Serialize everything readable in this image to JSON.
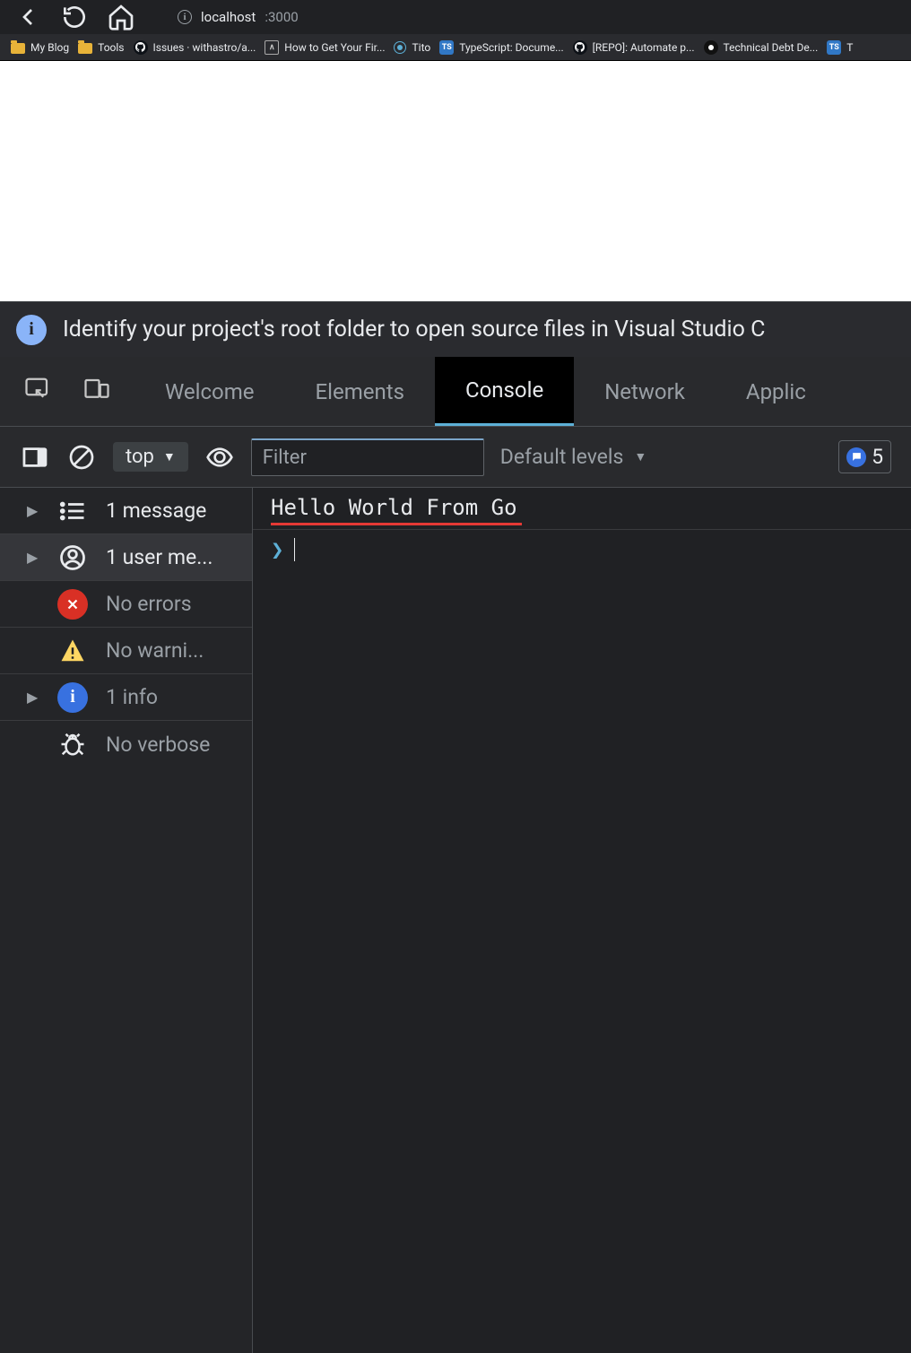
{
  "browser": {
    "url_host": "localhost",
    "url_port": ":3000"
  },
  "bookmarks": [
    {
      "label": "My Blog",
      "kind": "folder"
    },
    {
      "label": "Tools",
      "kind": "folder"
    },
    {
      "label": "Issues · withastro/a...",
      "kind": "github"
    },
    {
      "label": "How to Get Your Fir...",
      "kind": "a"
    },
    {
      "label": "Tito",
      "kind": "circle"
    },
    {
      "label": "TypeScript: Docume...",
      "kind": "ts"
    },
    {
      "label": "[REPO]: Automate p...",
      "kind": "github"
    },
    {
      "label": "Technical Debt De...",
      "kind": "dark"
    },
    {
      "label": "T",
      "kind": "ts"
    }
  ],
  "banner": "Identify your project's root folder to open source files in Visual Studio C",
  "tabs": {
    "items": [
      "Welcome",
      "Elements",
      "Console",
      "Network",
      "Applic"
    ],
    "activeIndex": 2
  },
  "toolbar": {
    "context": "top",
    "filter_placeholder": "Filter",
    "levels": "Default levels",
    "issues": "5"
  },
  "sidebar": {
    "rows": [
      {
        "label": "1 message",
        "icon": "list",
        "arrow": true
      },
      {
        "label": "1 user me...",
        "icon": "user",
        "arrow": true,
        "selected": true
      },
      {
        "label": "No errors",
        "icon": "error",
        "arrow": false
      },
      {
        "label": "No warni...",
        "icon": "warn",
        "arrow": false
      },
      {
        "label": "1 info",
        "icon": "info",
        "arrow": true
      },
      {
        "label": "No verbose",
        "icon": "bug",
        "arrow": false
      }
    ]
  },
  "console": {
    "log": "Hello World From Go"
  }
}
